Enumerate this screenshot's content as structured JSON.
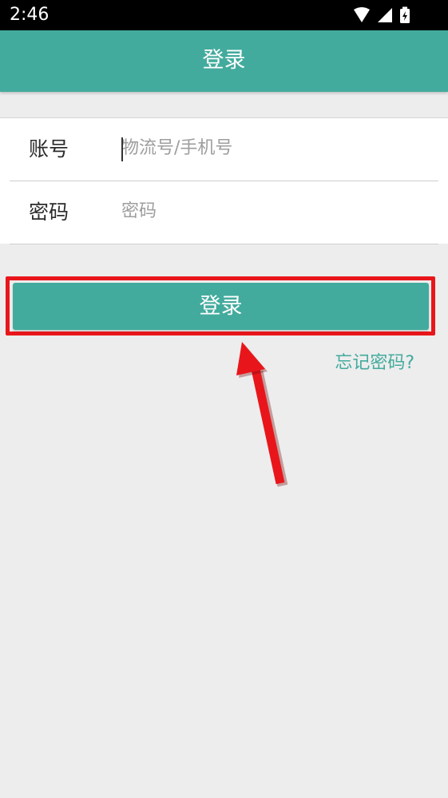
{
  "status_bar": {
    "time": "2:46",
    "icons": [
      "wifi-icon",
      "cell-signal-icon",
      "battery-charging-icon"
    ]
  },
  "app_bar": {
    "title": "登录"
  },
  "form": {
    "account": {
      "label": "账号",
      "placeholder": "物流号/手机号",
      "value": ""
    },
    "password": {
      "label": "密码",
      "placeholder": "密码",
      "value": ""
    }
  },
  "login_button": {
    "label": "登录"
  },
  "forgot_password": {
    "label": "忘记密码?"
  },
  "colors": {
    "accent": "#43ab9d",
    "background": "#ededed",
    "highlight": "#e8161b",
    "status_bar": "#000000"
  }
}
